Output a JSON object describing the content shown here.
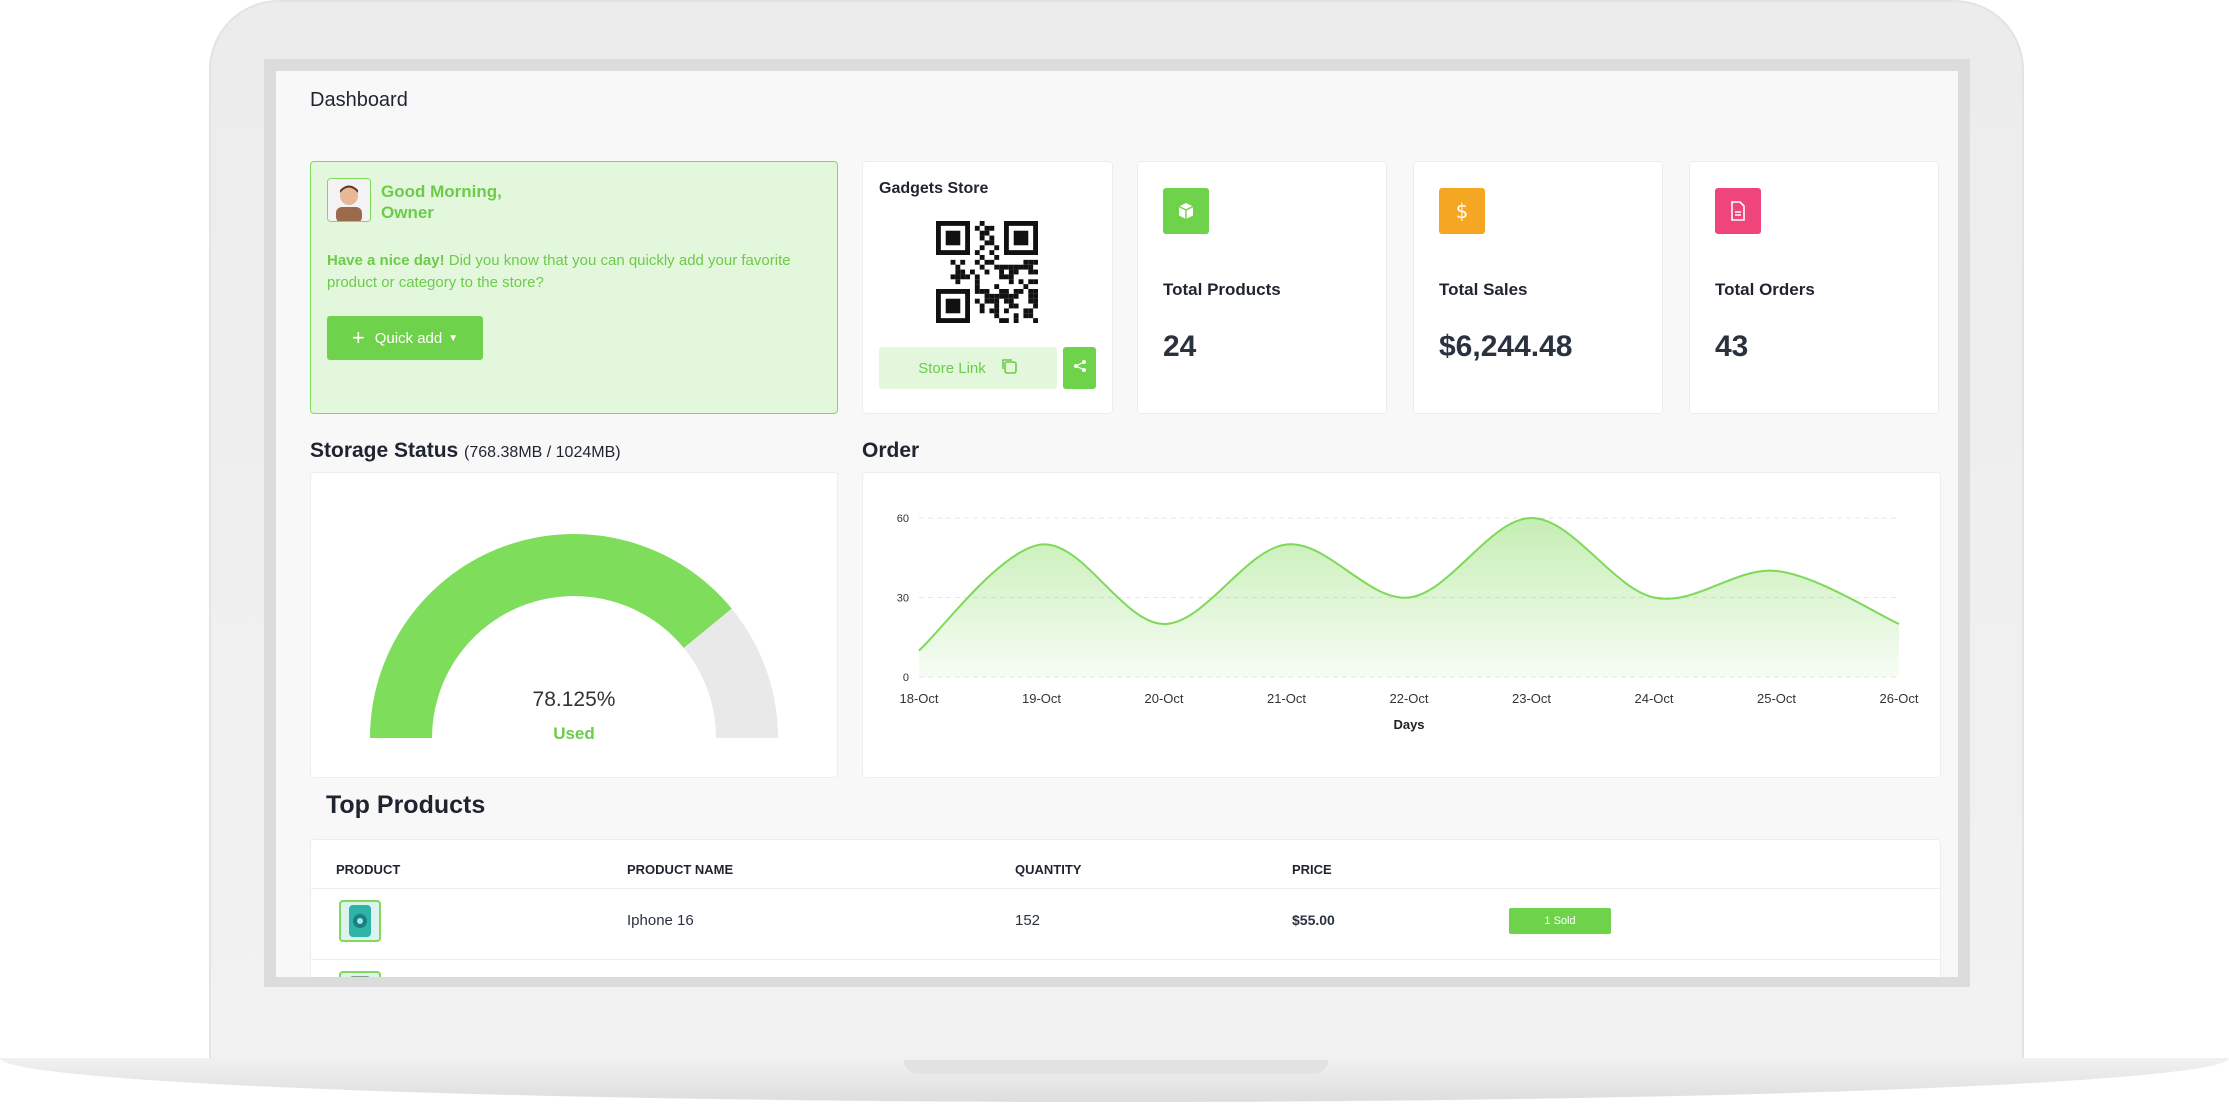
{
  "page": {
    "title": "Dashboard"
  },
  "welcome": {
    "greeting": "Good Morning,",
    "name": "Owner",
    "tip_bold": "Have a nice day!",
    "tip_text": " Did you know that you can quickly add your favorite product or category to the store?",
    "quick_add_label": "Quick add"
  },
  "store": {
    "name": "Gadgets Store",
    "link_label": "Store Link"
  },
  "stats": [
    {
      "label": "Total Products",
      "value": "24",
      "color": "#6ed34a",
      "icon": "box-icon"
    },
    {
      "label": "Total Sales",
      "value": "$6,244.48",
      "color": "#f5a623",
      "icon": "dollar-icon"
    },
    {
      "label": "Total Orders",
      "value": "43",
      "color": "#f0457a",
      "icon": "document-icon"
    }
  ],
  "storage": {
    "title": "Storage Status",
    "detail": "(768.38MB / 1024MB)",
    "percent": 78.125,
    "percent_label": "78.125%",
    "used_label": "Used",
    "used_color": "#7edd5a",
    "free_color": "#e9e9e9"
  },
  "chart_data": {
    "type": "area",
    "title": "Order",
    "xlabel": "Days",
    "ylabel": "",
    "x": [
      "18-Oct",
      "19-Oct",
      "20-Oct",
      "21-Oct",
      "22-Oct",
      "23-Oct",
      "24-Oct",
      "25-Oct",
      "26-Oct"
    ],
    "series": [
      {
        "values": [
          10,
          50,
          20,
          50,
          30,
          60,
          30,
          40,
          20
        ]
      }
    ],
    "ylim": [
      0,
      60
    ],
    "yticks": [
      0,
      30,
      60
    ],
    "grid": true,
    "color": "#7ed957"
  },
  "top_products": {
    "title": "Top Products",
    "columns": [
      "PRODUCT",
      "PRODUCT NAME",
      "QUANTITY",
      "PRICE"
    ],
    "rows": [
      {
        "name": "Iphone 16",
        "quantity": "152",
        "price": "$55.00",
        "badge": "1 Sold"
      }
    ]
  }
}
